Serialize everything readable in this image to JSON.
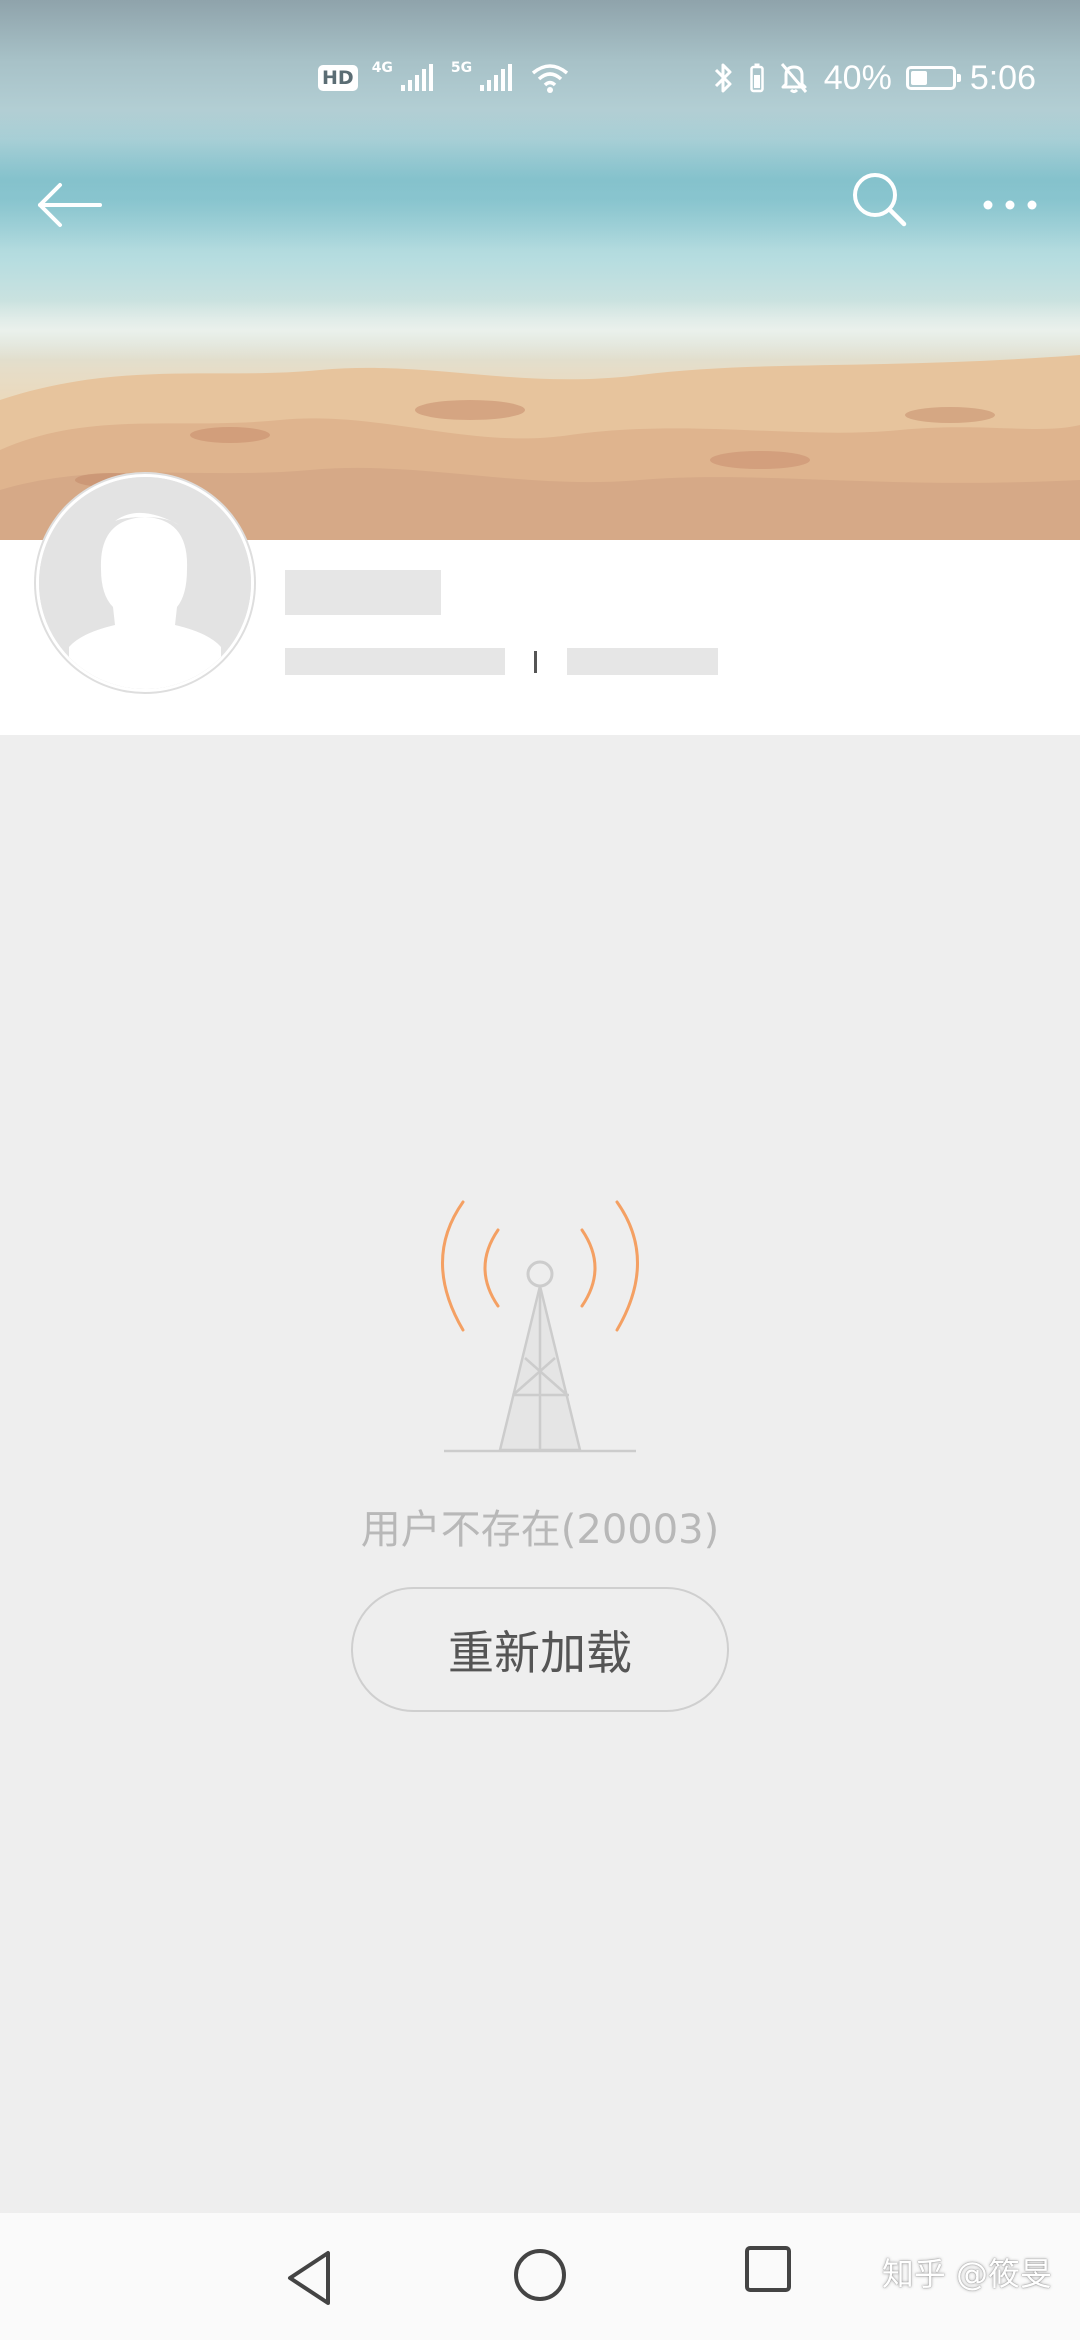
{
  "status_bar": {
    "left_badges": [
      "HD",
      "4G",
      "5G"
    ],
    "battery_percent": "40%",
    "battery_level": 0.4,
    "time": "5:06",
    "icons": [
      "hd-icon",
      "signal-icon",
      "signal-icon",
      "wifi-icon",
      "bluetooth-icon",
      "battery-small-icon",
      "mute-bell-icon",
      "battery-icon"
    ]
  },
  "app_bar": {
    "icons": [
      "back-arrow-icon",
      "search-icon",
      "more-icon"
    ]
  },
  "profile": {
    "avatar": "default-avatar-icon"
  },
  "error": {
    "message": "用户不存在(20003)",
    "reload_label": "重新加载",
    "illustration": "signal-tower-icon",
    "accent_color": "#f4a063"
  },
  "nav_bar": {
    "icons": [
      "nav-back-icon",
      "nav-home-icon",
      "nav-recents-icon"
    ]
  },
  "watermark": "知乎 @筱旻"
}
